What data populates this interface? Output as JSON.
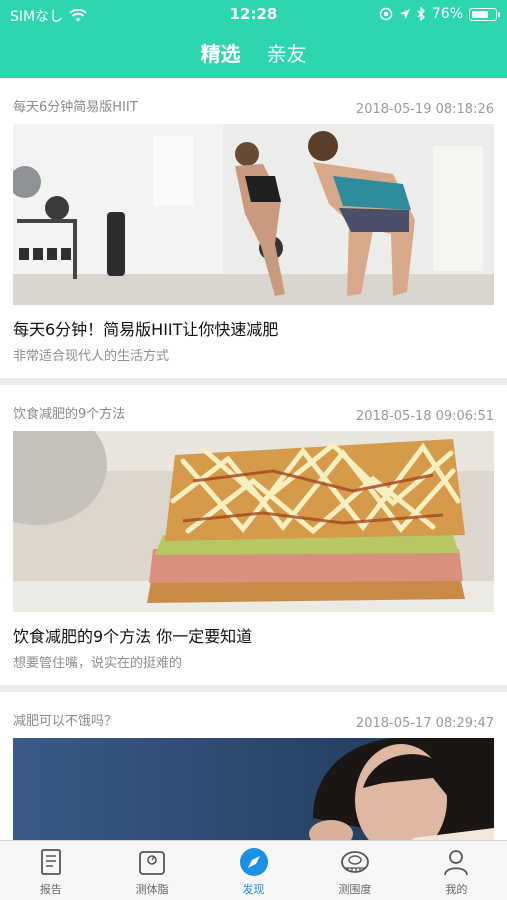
{
  "status_bar": {
    "carrier": "SIMなし",
    "time": "12:28",
    "battery": "76%",
    "battery_level": 0.76
  },
  "top_tabs": [
    {
      "label": "精选",
      "active": true
    },
    {
      "label": "亲友",
      "active": false
    }
  ],
  "articles": [
    {
      "category": "每天6分钟简易版HIIT",
      "date": "2018-05-19 08:18:26",
      "title": "每天6分钟！简易版HIIT让你快速减肥",
      "subtitle": "非常适合现代人的生活方式",
      "image": "fitness-workout-photo"
    },
    {
      "category": "饮食减肥的9个方法",
      "date": "2018-05-18 09:06:51",
      "title": "饮食减肥的9个方法 你一定要知道",
      "subtitle": "想要管住嘴，说实在的挺难的",
      "image": "sandwich-photo"
    },
    {
      "category": "减肥可以不饿吗？",
      "date": "2018-05-17 08:29:47",
      "title": "",
      "subtitle": "",
      "image": "woman-portrait-photo"
    }
  ],
  "bottom_tabs": [
    {
      "label": "报告",
      "icon": "report-icon",
      "active": false
    },
    {
      "label": "测体脂",
      "icon": "scale-icon",
      "active": false
    },
    {
      "label": "发现",
      "icon": "compass-icon",
      "active": true
    },
    {
      "label": "测围度",
      "icon": "tape-measure-icon",
      "active": false
    },
    {
      "label": "我的",
      "icon": "profile-icon",
      "active": false
    }
  ],
  "colors": {
    "brand": "#2ed6b0",
    "active_tab": "#1a90e6"
  }
}
